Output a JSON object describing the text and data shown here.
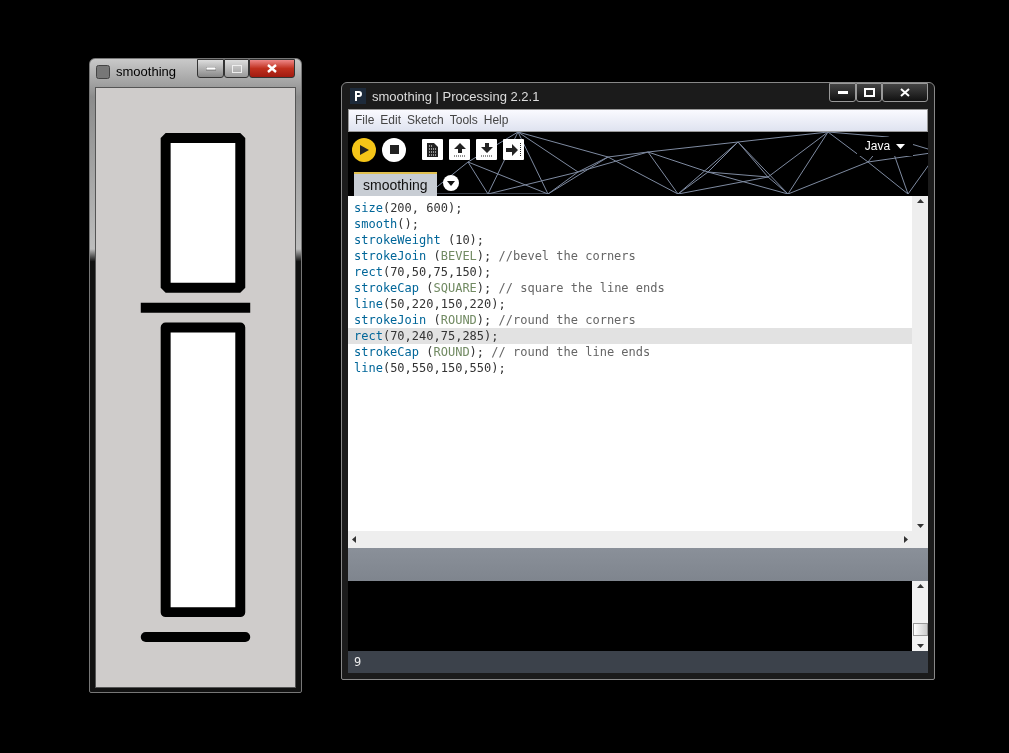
{
  "sketch_window": {
    "title": "smoothing"
  },
  "ide_window": {
    "title": "smoothing | Processing 2.2.1",
    "menu": [
      "File",
      "Edit",
      "Sketch",
      "Tools",
      "Help"
    ],
    "mode": "Java",
    "tabs": [
      {
        "label": "smoothing",
        "selected": true
      }
    ],
    "code_lines": [
      {
        "current": false,
        "tokens": [
          {
            "kind": "function",
            "text": "size"
          },
          {
            "kind": "plain",
            "text": "(200, 600);"
          }
        ]
      },
      {
        "current": false,
        "tokens": [
          {
            "kind": "function",
            "text": "smooth"
          },
          {
            "kind": "plain",
            "text": "();"
          }
        ]
      },
      {
        "current": false,
        "tokens": [
          {
            "kind": "function",
            "text": "strokeWeight"
          },
          {
            "kind": "plain",
            "text": " (10);"
          }
        ]
      },
      {
        "current": false,
        "tokens": [
          {
            "kind": "function",
            "text": "strokeJoin"
          },
          {
            "kind": "plain",
            "text": " ("
          },
          {
            "kind": "constant",
            "text": "BEVEL"
          },
          {
            "kind": "plain",
            "text": "); "
          },
          {
            "kind": "comment",
            "text": "//bevel the corners"
          }
        ]
      },
      {
        "current": false,
        "tokens": [
          {
            "kind": "function",
            "text": "rect"
          },
          {
            "kind": "plain",
            "text": "(70,50,75,150);"
          }
        ]
      },
      {
        "current": false,
        "tokens": [
          {
            "kind": "function",
            "text": "strokeCap"
          },
          {
            "kind": "plain",
            "text": " ("
          },
          {
            "kind": "constant",
            "text": "SQUARE"
          },
          {
            "kind": "plain",
            "text": "); "
          },
          {
            "kind": "comment",
            "text": "// square the line ends"
          }
        ]
      },
      {
        "current": false,
        "tokens": [
          {
            "kind": "function",
            "text": "line"
          },
          {
            "kind": "plain",
            "text": "(50,220,150,220);"
          }
        ]
      },
      {
        "current": false,
        "tokens": [
          {
            "kind": "function",
            "text": "strokeJoin"
          },
          {
            "kind": "plain",
            "text": " ("
          },
          {
            "kind": "constant",
            "text": "ROUND"
          },
          {
            "kind": "plain",
            "text": "); "
          },
          {
            "kind": "comment",
            "text": "//round the corners"
          }
        ]
      },
      {
        "current": true,
        "tokens": [
          {
            "kind": "function",
            "text": "rect"
          },
          {
            "kind": "plain",
            "text": "(70,240,75,285);"
          }
        ]
      },
      {
        "current": false,
        "tokens": [
          {
            "kind": "function",
            "text": "strokeCap"
          },
          {
            "kind": "plain",
            "text": " ("
          },
          {
            "kind": "constant",
            "text": "ROUND"
          },
          {
            "kind": "plain",
            "text": "); "
          },
          {
            "kind": "comment",
            "text": "// round the line ends"
          }
        ]
      },
      {
        "current": false,
        "tokens": [
          {
            "kind": "function",
            "text": "line"
          },
          {
            "kind": "plain",
            "text": "(50,550,150,550);"
          }
        ]
      }
    ],
    "status_line": "9"
  }
}
